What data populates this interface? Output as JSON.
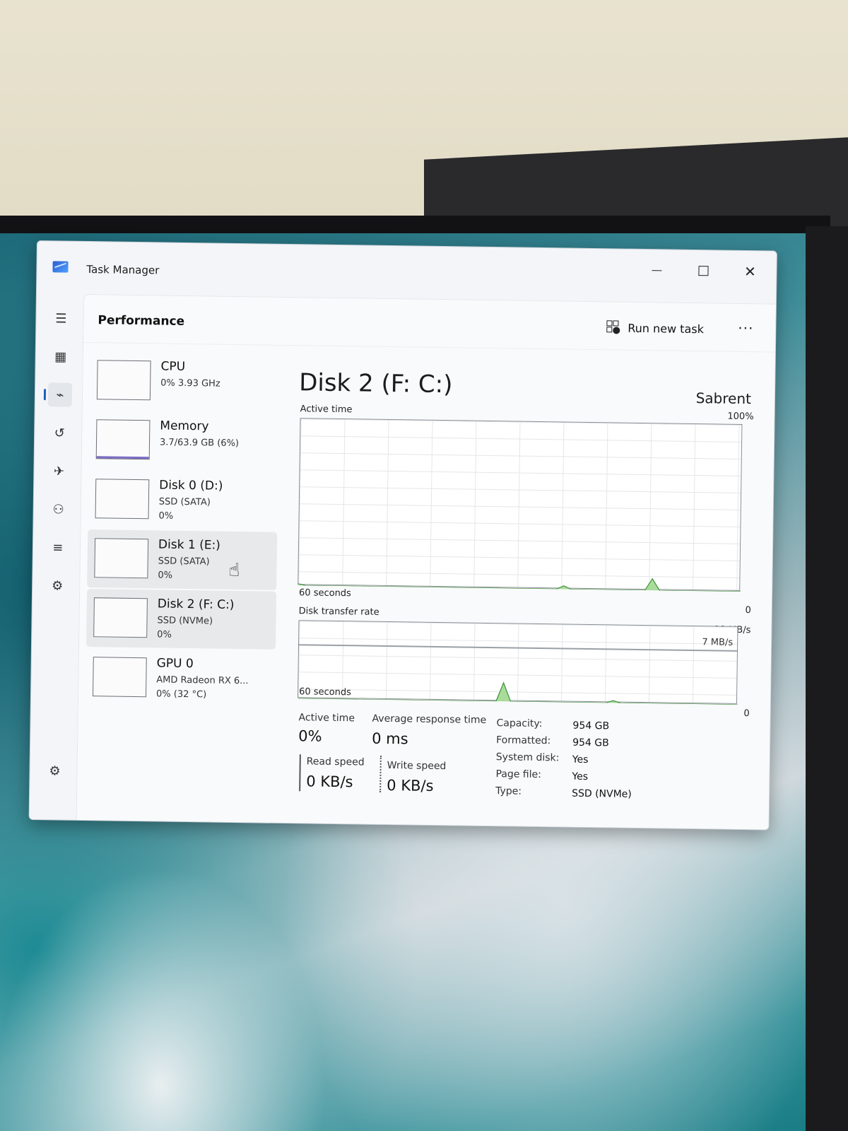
{
  "window": {
    "title": "Task Manager",
    "controls": {
      "minimize": "minimize",
      "maximize": "maximize",
      "close": "✕"
    }
  },
  "nav": {
    "items": [
      {
        "icon": "hamburger-menu-icon",
        "glyph": "☰"
      },
      {
        "icon": "processes-icon",
        "glyph": "▦"
      },
      {
        "icon": "performance-icon",
        "glyph": "⌁",
        "active": true
      },
      {
        "icon": "app-history-icon",
        "glyph": "↺"
      },
      {
        "icon": "startup-apps-icon",
        "glyph": "✈"
      },
      {
        "icon": "users-icon",
        "glyph": "⚇"
      },
      {
        "icon": "details-icon",
        "glyph": "≡"
      },
      {
        "icon": "services-icon",
        "glyph": "⚙"
      }
    ],
    "settings_glyph": "⚙"
  },
  "header": {
    "title": "Performance",
    "run_new_task": "Run new task",
    "more": "···"
  },
  "devices": [
    {
      "name": "CPU",
      "sub": "0% 3.93 GHz",
      "sub2": ""
    },
    {
      "name": "Memory",
      "sub": "3.7/63.9 GB (6%)",
      "sub2": ""
    },
    {
      "name": "Disk 0 (D:)",
      "sub": "SSD (SATA)",
      "sub2": "0%"
    },
    {
      "name": "Disk 1 (E:)",
      "sub": "SSD (SATA)",
      "sub2": "0%"
    },
    {
      "name": "Disk 2 (F: C:)",
      "sub": "SSD (NVMe)",
      "sub2": "0%"
    },
    {
      "name": "GPU 0",
      "sub": "AMD Radeon RX 6...",
      "sub2": "0% (32 °C)"
    }
  ],
  "detail": {
    "title": "Disk 2 (F: C:)",
    "model": "Sabrent",
    "active_time_graph": {
      "label": "Active time",
      "max_label": "100%",
      "time_label": "60 seconds",
      "min_label": "0",
      "ylim": [
        0,
        100
      ],
      "samples": [
        1,
        0,
        0,
        0,
        0,
        0,
        0,
        0,
        0,
        0,
        0,
        0,
        0,
        0,
        0,
        0,
        0,
        0,
        0,
        0,
        0,
        0,
        0,
        0,
        0,
        0,
        0,
        0,
        0,
        0,
        0,
        0,
        0,
        0,
        0,
        0,
        2,
        0,
        0,
        0,
        0,
        0,
        0,
        0,
        0,
        0,
        0,
        0,
        7,
        0,
        0,
        0,
        0,
        0,
        0,
        0,
        0,
        0,
        0,
        0,
        0
      ]
    },
    "transfer_graph": {
      "label": "Disk transfer rate",
      "max_label": "10 MB/s",
      "ref_label": "7 MB/s",
      "time_label": "60 seconds",
      "min_label": "0",
      "ylim": [
        0,
        10
      ],
      "ref_value": 7,
      "samples": [
        0,
        0,
        0,
        0,
        0,
        0,
        0,
        0,
        0,
        0,
        0,
        0,
        0,
        0,
        0,
        0,
        0,
        0,
        0,
        0,
        0,
        0,
        0,
        0,
        0,
        0,
        0,
        0,
        2.4,
        0,
        0,
        0,
        0,
        0,
        0,
        0,
        0,
        0,
        0,
        0,
        0,
        0,
        0,
        0.3,
        0,
        0,
        0,
        0,
        0,
        0,
        0,
        0,
        0,
        0,
        0,
        0,
        0,
        0,
        0,
        0,
        0
      ]
    },
    "stats": {
      "active_time_label": "Active time",
      "active_time_value": "0%",
      "avg_response_label": "Average response time",
      "avg_response_value": "0 ms",
      "read_speed_label": "Read speed",
      "read_speed_value": "0 KB/s",
      "write_speed_label": "Write speed",
      "write_speed_value": "0 KB/s"
    },
    "properties": [
      {
        "key": "Capacity:",
        "value": "954 GB"
      },
      {
        "key": "Formatted:",
        "value": "954 GB"
      },
      {
        "key": "System disk:",
        "value": "Yes"
      },
      {
        "key": "Page file:",
        "value": "Yes"
      },
      {
        "key": "Type:",
        "value": "SSD (NVMe)"
      }
    ]
  },
  "colors": {
    "graph_line": "#3f8f3a",
    "graph_fill": "#a9dc9a",
    "accent": "#1f5fbf"
  }
}
